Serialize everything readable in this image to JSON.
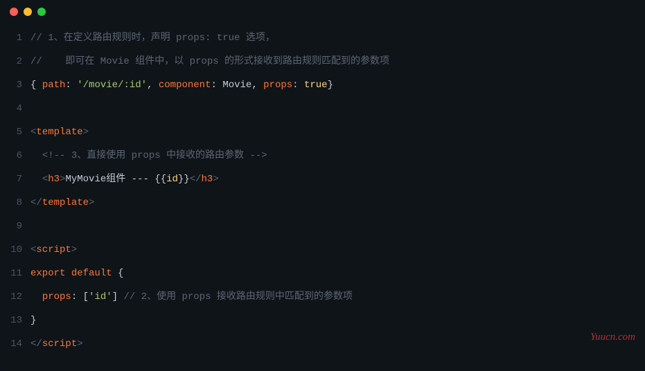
{
  "titlebar": {
    "dots": [
      "red",
      "yellow",
      "green"
    ]
  },
  "watermark": "Yuucn.com",
  "lines": [
    {
      "num": "1",
      "tokens": [
        {
          "cls": "c-comment",
          "t": "// 1、在定义路由规则时，声明 props: true 选项，"
        }
      ]
    },
    {
      "num": "2",
      "tokens": [
        {
          "cls": "c-comment",
          "t": "//    即可在 Movie 组件中，以 props 的形式接收到路由规则匹配到的参数项"
        }
      ]
    },
    {
      "num": "3",
      "tokens": [
        {
          "cls": "c-punct",
          "t": "{ "
        },
        {
          "cls": "c-key",
          "t": "path"
        },
        {
          "cls": "c-punct",
          "t": ": "
        },
        {
          "cls": "c-string",
          "t": "'/movie/:id'"
        },
        {
          "cls": "c-punct",
          "t": ", "
        },
        {
          "cls": "c-key",
          "t": "component"
        },
        {
          "cls": "c-punct",
          "t": ": "
        },
        {
          "cls": "c-ident",
          "t": "Movie"
        },
        {
          "cls": "c-punct",
          "t": ", "
        },
        {
          "cls": "c-key",
          "t": "props"
        },
        {
          "cls": "c-punct",
          "t": ": "
        },
        {
          "cls": "c-bool",
          "t": "true"
        },
        {
          "cls": "c-punct",
          "t": "}"
        }
      ]
    },
    {
      "num": "4",
      "tokens": [
        {
          "cls": "c-default",
          "t": ""
        }
      ]
    },
    {
      "num": "5",
      "tokens": [
        {
          "cls": "c-brack",
          "t": "<"
        },
        {
          "cls": "c-tag",
          "t": "template"
        },
        {
          "cls": "c-brack",
          "t": ">"
        }
      ]
    },
    {
      "num": "6",
      "tokens": [
        {
          "cls": "c-default",
          "t": "  "
        },
        {
          "cls": "c-comment",
          "t": "<!-- 3、直接使用 props 中接收的路由参数 -->"
        }
      ]
    },
    {
      "num": "7",
      "tokens": [
        {
          "cls": "c-default",
          "t": "  "
        },
        {
          "cls": "c-brack",
          "t": "<"
        },
        {
          "cls": "c-tag",
          "t": "h3"
        },
        {
          "cls": "c-brack",
          "t": ">"
        },
        {
          "cls": "c-default",
          "t": "MyMovie组件 --- {{"
        },
        {
          "cls": "c-attr",
          "t": "id"
        },
        {
          "cls": "c-default",
          "t": "}}"
        },
        {
          "cls": "c-brack",
          "t": "</"
        },
        {
          "cls": "c-tag",
          "t": "h3"
        },
        {
          "cls": "c-brack",
          "t": ">"
        }
      ]
    },
    {
      "num": "8",
      "tokens": [
        {
          "cls": "c-brack",
          "t": "</"
        },
        {
          "cls": "c-tag",
          "t": "template"
        },
        {
          "cls": "c-brack",
          "t": ">"
        }
      ]
    },
    {
      "num": "9",
      "tokens": [
        {
          "cls": "c-default",
          "t": ""
        }
      ]
    },
    {
      "num": "10",
      "tokens": [
        {
          "cls": "c-brack",
          "t": "<"
        },
        {
          "cls": "c-tag",
          "t": "script"
        },
        {
          "cls": "c-brack",
          "t": ">"
        }
      ]
    },
    {
      "num": "11",
      "tokens": [
        {
          "cls": "c-keyword",
          "t": "export"
        },
        {
          "cls": "c-default",
          "t": " "
        },
        {
          "cls": "c-keyword",
          "t": "default"
        },
        {
          "cls": "c-default",
          "t": " "
        },
        {
          "cls": "c-punct",
          "t": "{"
        }
      ]
    },
    {
      "num": "12",
      "tokens": [
        {
          "cls": "c-default",
          "t": "  "
        },
        {
          "cls": "c-key",
          "t": "props"
        },
        {
          "cls": "c-punct",
          "t": ": ["
        },
        {
          "cls": "c-string",
          "t": "'id'"
        },
        {
          "cls": "c-punct",
          "t": "] "
        },
        {
          "cls": "c-comment",
          "t": "// 2、使用 props 接收路由规则中匹配到的参数项"
        }
      ]
    },
    {
      "num": "13",
      "tokens": [
        {
          "cls": "c-punct",
          "t": "}"
        }
      ]
    },
    {
      "num": "14",
      "tokens": [
        {
          "cls": "c-brack",
          "t": "</"
        },
        {
          "cls": "c-tag",
          "t": "script"
        },
        {
          "cls": "c-brack",
          "t": ">"
        }
      ]
    }
  ]
}
